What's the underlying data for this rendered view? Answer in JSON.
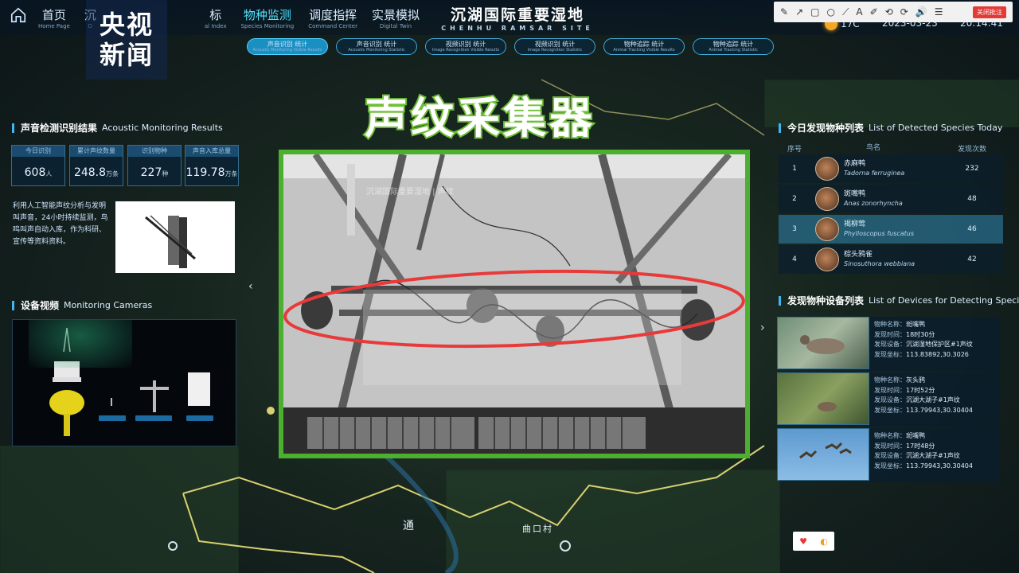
{
  "nav": {
    "items": [
      {
        "cn": "首页",
        "en": "Home Page"
      },
      {
        "cn": "沉",
        "en": "D"
      },
      {
        "cn": "标",
        "en": "al Index"
      },
      {
        "cn": "物种监测",
        "en": "Species Monitoring"
      },
      {
        "cn": "调度指挥",
        "en": "Command Center"
      },
      {
        "cn": "实景模拟",
        "en": "Digital Twin"
      }
    ]
  },
  "site": {
    "title_cn": "沉湖国际重要湿地",
    "title_en": "CHENHU RAMSAR SITE"
  },
  "weather": {
    "temp": "17C"
  },
  "datetime": {
    "date": "2023-03-23",
    "time": "20:14:41"
  },
  "logo": {
    "line1": "央视",
    "line2": "新闻"
  },
  "annotation_toolbar": {
    "tools": [
      "✎",
      "↗",
      "▢",
      "○",
      "⟋",
      "A",
      "✐",
      "⟲",
      "⟳",
      "🔊",
      "☰"
    ],
    "close_label": "关闭批注"
  },
  "subtabs": [
    {
      "cn": "声音识别 统计",
      "en": "Acoustic Monitoring Visible Results"
    },
    {
      "cn": "声音识别 统计",
      "en": "Acoustic Monitoring Statistic"
    },
    {
      "cn": "视频识别 统计",
      "en": "Image Recognition Visible Results"
    },
    {
      "cn": "视频识别 统计",
      "en": "Image Recognition Statistic"
    },
    {
      "cn": "物种追踪 统计",
      "en": "Animal Tracking Visible Results"
    },
    {
      "cn": "物种追踪 统计",
      "en": "Animal Tracking Statistic"
    }
  ],
  "acoustic": {
    "title_cn": "声音检测识别结果",
    "title_en": "Acoustic Monitoring Results",
    "stats": [
      {
        "label": "今日识别",
        "value": "608",
        "unit": "人"
      },
      {
        "label": "累计声纹数量",
        "value": "248.8",
        "unit": "万条"
      },
      {
        "label": "识别物种",
        "value": "227",
        "unit": "种"
      },
      {
        "label": "声音入库总量",
        "value": "119.78",
        "unit": "万条"
      }
    ],
    "description": "利用人工智能声纹分析与发明叫声音，24小时持续监测，鸟鸣叫声自动入库，作为科研、宣传等资料资料。"
  },
  "cameras": {
    "title_cn": "设备视频",
    "title_en": "Monitoring Cameras"
  },
  "video": {
    "caption": "声纹采集器",
    "overlay_text": "沉湖国际重要湿地 | 声纹"
  },
  "species_today": {
    "title_cn": "今日发现物种列表",
    "title_en": "List of Detected Species Today",
    "headers": [
      "序号",
      "鸟名",
      "发现次数"
    ],
    "rows": [
      {
        "idx": "1",
        "name": "赤麻鸭",
        "latin": "Tadorna ferruginea",
        "count": "232"
      },
      {
        "idx": "2",
        "name": "斑嘴鸭",
        "latin": "Anas zonorhyncha",
        "count": "48"
      },
      {
        "idx": "3",
        "name": "褐柳莺",
        "latin": "Phylloscopus fuscatus",
        "count": "46"
      },
      {
        "idx": "4",
        "name": "棕头鸦雀",
        "latin": "Sinosuthora webbiana",
        "count": "42"
      }
    ]
  },
  "devices": {
    "title_cn": "发现物种设备列表",
    "title_en": "List of Devices for Detecting Species",
    "keys": {
      "species": "物种名称：",
      "time": "发现时间：",
      "device": "发现设备：",
      "coords": "发现坐标："
    },
    "cards": [
      {
        "species": "斑嘴鸭",
        "time": "18时30分",
        "device": "沉湖湿地保护区#1声纹",
        "coords": "113.83892,30.3026"
      },
      {
        "species": "灰头鸦",
        "time": "17时52分",
        "device": "沉湖大湖子#1声纹",
        "coords": "113.79943,30.30404"
      },
      {
        "species": "斑嘴鸭",
        "time": "17时48分",
        "device": "沉湖大湖子#1声纹",
        "coords": "113.79943,30.30404"
      }
    ]
  },
  "map_labels": {
    "place1": "通",
    "place2": "曲口村"
  },
  "colors": {
    "accent": "#3fb6f0",
    "frame_green": "#4caf2f",
    "highlight_red": "#e83a3a"
  }
}
